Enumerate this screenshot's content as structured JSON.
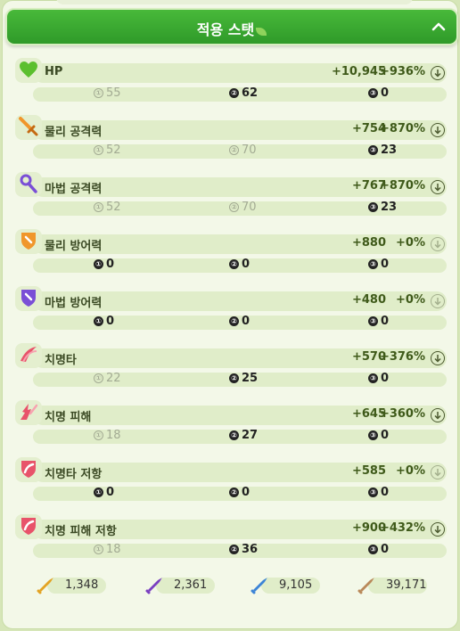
{
  "header": {
    "title": "적용 스탯"
  },
  "stats": [
    {
      "label": "HP",
      "value": "+10,945",
      "percent": "+936%",
      "dim": false,
      "icon": "heart-icon",
      "color": "#5bbf2e",
      "slots": [
        {
          "n": "①",
          "v": "55",
          "dim": true
        },
        {
          "n": "②",
          "v": "62",
          "dim": false
        },
        {
          "n": "③",
          "v": "0",
          "dim": false
        }
      ]
    },
    {
      "label": "물리 공격력",
      "value": "+754",
      "percent": "+870%",
      "dim": false,
      "icon": "sword-icon",
      "color": "#f0962b",
      "slots": [
        {
          "n": "①",
          "v": "52",
          "dim": true
        },
        {
          "n": "②",
          "v": "70",
          "dim": true
        },
        {
          "n": "③",
          "v": "23",
          "dim": false
        }
      ]
    },
    {
      "label": "마법 공격력",
      "value": "+767",
      "percent": "+870%",
      "dim": false,
      "icon": "staff-icon",
      "color": "#7a4fd6",
      "slots": [
        {
          "n": "①",
          "v": "52",
          "dim": true
        },
        {
          "n": "②",
          "v": "70",
          "dim": true
        },
        {
          "n": "③",
          "v": "23",
          "dim": false
        }
      ]
    },
    {
      "label": "물리 방어력",
      "value": "+880",
      "percent": "+0%",
      "dim": true,
      "icon": "shield-orange-icon",
      "color": "#f0962b",
      "slots": [
        {
          "n": "①",
          "v": "0",
          "dim": false
        },
        {
          "n": "②",
          "v": "0",
          "dim": false
        },
        {
          "n": "③",
          "v": "0",
          "dim": false
        }
      ]
    },
    {
      "label": "마법 방어력",
      "value": "+480",
      "percent": "+0%",
      "dim": true,
      "icon": "shield-purple-icon",
      "color": "#7a4fd6",
      "slots": [
        {
          "n": "①",
          "v": "0",
          "dim": false
        },
        {
          "n": "②",
          "v": "0",
          "dim": false
        },
        {
          "n": "③",
          "v": "0",
          "dim": false
        }
      ]
    },
    {
      "label": "치명타",
      "value": "+570",
      "percent": "+376%",
      "dim": false,
      "icon": "critical-icon",
      "color": "#e8536a",
      "slots": [
        {
          "n": "①",
          "v": "22",
          "dim": true
        },
        {
          "n": "②",
          "v": "25",
          "dim": false
        },
        {
          "n": "③",
          "v": "0",
          "dim": false
        }
      ]
    },
    {
      "label": "치명 피해",
      "value": "+645",
      "percent": "+360%",
      "dim": false,
      "icon": "critical-damage-icon",
      "color": "#e8536a",
      "slots": [
        {
          "n": "①",
          "v": "18",
          "dim": true
        },
        {
          "n": "②",
          "v": "27",
          "dim": false
        },
        {
          "n": "③",
          "v": "0",
          "dim": false
        }
      ]
    },
    {
      "label": "치명타 저항",
      "value": "+585",
      "percent": "+0%",
      "dim": true,
      "icon": "critical-resist-icon",
      "color": "#e8536a",
      "slots": [
        {
          "n": "①",
          "v": "0",
          "dim": false
        },
        {
          "n": "②",
          "v": "0",
          "dim": false
        },
        {
          "n": "③",
          "v": "0",
          "dim": false
        }
      ]
    },
    {
      "label": "치명 피해 저항",
      "value": "+900",
      "percent": "+432%",
      "dim": false,
      "icon": "critical-damage-resist-icon",
      "color": "#e8536a",
      "slots": [
        {
          "n": "①",
          "v": "18",
          "dim": true
        },
        {
          "n": "②",
          "v": "36",
          "dim": false
        },
        {
          "n": "③",
          "v": "0",
          "dim": false
        }
      ]
    }
  ],
  "currencies": [
    {
      "name": "gold-bullet-icon",
      "value": "1,348",
      "color": "#e3a323"
    },
    {
      "name": "purple-bullet-icon",
      "value": "2,361",
      "color": "#7a3fc0"
    },
    {
      "name": "blue-bullet-icon",
      "value": "9,105",
      "color": "#3c84d6"
    },
    {
      "name": "bronze-bullet-icon",
      "value": "39,171",
      "color": "#b9895a"
    }
  ]
}
